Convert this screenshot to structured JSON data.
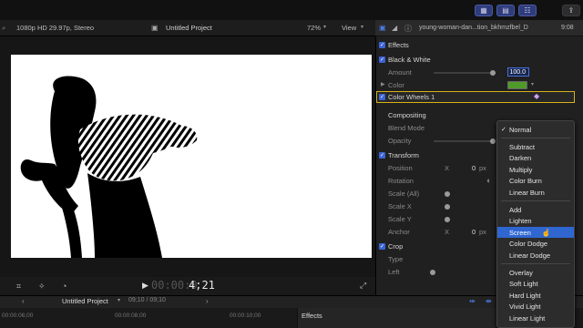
{
  "toolbar": {
    "layout_icons": [
      "library-icon",
      "timeline-icon",
      "inspector-toggle-icon"
    ],
    "share_icon": "share-icon"
  },
  "viewer": {
    "format": "1080p HD 29.97p, Stereo",
    "project": "Untitled Project",
    "zoom": "72%",
    "view_label": "View"
  },
  "transport": {
    "timecode_dim": "00:00:0",
    "timecode_bright": "4;21"
  },
  "timeline": {
    "project": "Untitled Project",
    "position": "09;10 / 09;10",
    "ruler_ticks": [
      "00:00:06;00",
      "00:00:08;00",
      "00:00:10;00"
    ],
    "effects_label": "Effects"
  },
  "inspector": {
    "clip_name": "young-woman-dan...tion_bkhmzfbel_D",
    "clip_duration": "9:08",
    "effects_header": "Effects",
    "bw_label": "Black & White",
    "amount_label": "Amount",
    "amount_value": "100.0",
    "amount_level": 1.0,
    "color_label": "Color",
    "color_swatch": "#4f9a2a",
    "color_wheels_label": "Color Wheels 1",
    "compositing_label": "Compositing",
    "blend_mode_label": "Blend Mode",
    "opacity_label": "Opacity",
    "transform_label": "Transform",
    "position_label": "Position",
    "position_axis": "X",
    "position_value": "0",
    "unit_px": "px",
    "rotation_label": "Rotation",
    "scale_all_label": "Scale (All)",
    "scale_x_label": "Scale X",
    "scale_y_label": "Scale Y",
    "anchor_label": "Anchor",
    "anchor_axis": "X",
    "anchor_value": "0",
    "crop_label": "Crop",
    "type_label": "Type",
    "left_label": "Left"
  },
  "blend_menu": {
    "items": [
      "Normal",
      "Subtract",
      "Darken",
      "Multiply",
      "Color Burn",
      "Linear Burn",
      "Add",
      "Lighten",
      "Screen",
      "Color Dodge",
      "Linear Dodge",
      "Overlay",
      "Soft Light",
      "Hard Light",
      "Vivid Light",
      "Linear Light"
    ],
    "checked": "Normal",
    "highlighted": "Screen"
  },
  "colors": {
    "accent": "#2f66d0",
    "selection_outline": "#d6b21a"
  }
}
